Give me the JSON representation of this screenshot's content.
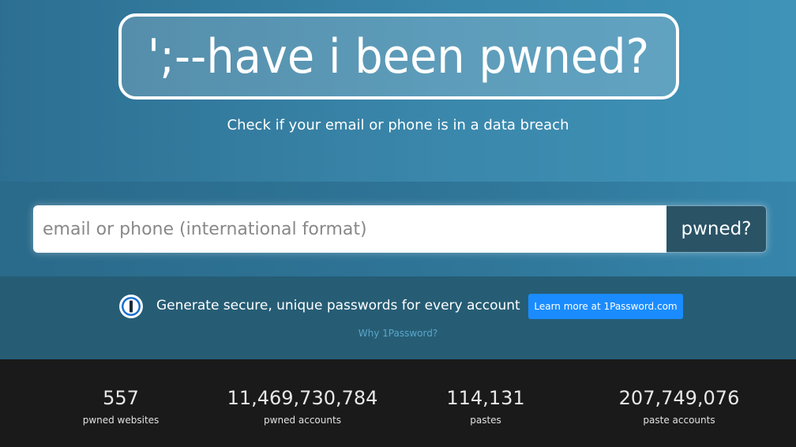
{
  "hero": {
    "logo_text": "';--have i been pwned?",
    "tagline": "Check if your email or phone is in a data breach"
  },
  "search": {
    "placeholder": "email or phone (international format)",
    "button_label": "pwned?"
  },
  "promo": {
    "icon": "1password-icon",
    "text": "Generate secure, unique passwords for every account",
    "button_label": "Learn more at 1Password.com",
    "why_link": "Why 1Password?",
    "accent_color": "#1a8cff"
  },
  "stats": [
    {
      "value": "557",
      "label": "pwned websites"
    },
    {
      "value": "11,469,730,784",
      "label": "pwned accounts"
    },
    {
      "value": "114,131",
      "label": "pastes"
    },
    {
      "value": "207,749,076",
      "label": "paste accounts"
    }
  ]
}
